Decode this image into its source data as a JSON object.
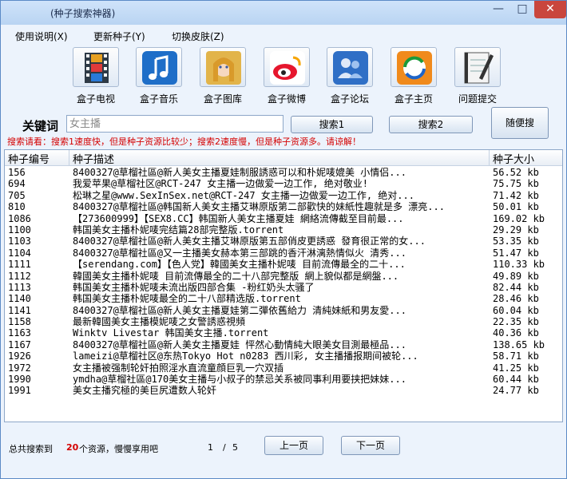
{
  "window": {
    "title": "(种子搜索神器)",
    "min": "—",
    "max": "□",
    "close": "✕"
  },
  "menu": [
    "使用说明(X)",
    "更新种子(Y)",
    "切换皮肤(Z)"
  ],
  "toolbar": [
    {
      "label": "盒子电视",
      "icon": "film-icon"
    },
    {
      "label": "盒子音乐",
      "icon": "music-note-icon"
    },
    {
      "label": "盒子图库",
      "icon": "portrait-icon"
    },
    {
      "label": "盒子微博",
      "icon": "weibo-icon"
    },
    {
      "label": "盒子论坛",
      "icon": "people-icon"
    },
    {
      "label": "盒子主页",
      "icon": "refresh-globe-icon"
    },
    {
      "label": "问题提交",
      "icon": "notebook-pen-icon"
    }
  ],
  "search": {
    "label": "关键词",
    "value": "",
    "placeholder": "女主播",
    "btn1": "搜索1",
    "btn2": "搜索2",
    "random": "随便搜",
    "hint": "搜索请看：搜索1速度快，但是种子资源比较少；搜索2速度慢，但是种子资源多。请谅解！"
  },
  "table": {
    "headers": [
      "种子编号",
      "种子描述",
      "种子大小"
    ],
    "rows": [
      {
        "id": "156",
        "desc": "8400327@草榴社區@新人美女主播夏娃制服誘惑可以和朴妮唛媲美 小情侣...",
        "size": "56.52 kb"
      },
      {
        "id": "694",
        "desc": "我爱苹果@草榴社区@RCT-247 女主播一边做爱一边工作, 绝对敬业!",
        "size": "75.75 kb"
      },
      {
        "id": "705",
        "desc": "松琳之星@www.SexInSex.net@RCT-247 女主播一边做爱一边工作, 绝对...",
        "size": "71.42 kb"
      },
      {
        "id": "810",
        "desc": "8400327@草榴社區@韩国新人美女主播艾琳原版第二部歡快的妹紙性趣就是多 漂亮...",
        "size": "50.01 kb"
      },
      {
        "id": "1086",
        "desc": "【273600999】【SEX8.CC】韩国新人美女主播夏娃 網絡流傳截至目前最...",
        "size": "169.02 kb"
      },
      {
        "id": "1100",
        "desc": "韩国美女主播朴妮唛完结篇28部完整版.torrent",
        "size": "29.29 kb"
      },
      {
        "id": "1103",
        "desc": "8400327@草榴社區@新人美女主播艾琳原版第五部俏皮更誘惑 發育很正常的女...",
        "size": "53.35 kb"
      },
      {
        "id": "1104",
        "desc": "8400327@草榴社區@又一主播美女赫本第三部跳的香汗淋漓熱情似火 清秀...",
        "size": "51.47 kb"
      },
      {
        "id": "1111",
        "desc": "【serendang.com】【色人党】韓國美女主播朴妮唛 目前流傳最全的二十...",
        "size": "110.33 kb"
      },
      {
        "id": "1112",
        "desc": "韓國美女主播朴妮唛 目前流傳最全的二十八部完整版 網上貌似都是網盤...",
        "size": "49.89 kb"
      },
      {
        "id": "1113",
        "desc": "韩国美女主播朴妮唛未流出版四部合集 -粉红奶头太骚了",
        "size": "82.44 kb"
      },
      {
        "id": "1140",
        "desc": "韩国美女主播朴妮唛最全的二十八部精选版.torrent",
        "size": "28.46 kb"
      },
      {
        "id": "1141",
        "desc": "8400327@草榴社區@新人美女主播夏娃第二彈依舊給力 清純妹紙和男友愛...",
        "size": "60.04 kb"
      },
      {
        "id": "1158",
        "desc": "最新韓國美女主播模妮唛之女警誘惑視頻",
        "size": "22.35 kb"
      },
      {
        "id": "1163",
        "desc": "Winktv Livestar 韩国美女主播.torrent",
        "size": "40.36 kb"
      },
      {
        "id": "1167",
        "desc": "8400327@草榴社區@新人美女主播夏娃 怦然心動情純大眼美女目測最極品...",
        "size": "138.65 kb"
      },
      {
        "id": "1926",
        "desc": "lameizi@草榴社区@东热Tokyo Hot n0283 西川彩, 女主播播报期间被轮...",
        "size": "58.71 kb"
      },
      {
        "id": "1972",
        "desc": "女主播被强制轮奸拍照淫水直流童顔巨乳一穴双插",
        "size": "41.25 kb"
      },
      {
        "id": "1990",
        "desc": "ymdha@草榴社區@170美女主播与小叔子的禁忌关系被同事利用要挟把妹妹...",
        "size": "60.44 kb"
      },
      {
        "id": "1991",
        "desc": "美女主播究極的美巨尻遭数人轮奸",
        "size": "24.77 kb"
      }
    ]
  },
  "status": {
    "prefix": "总共搜索到",
    "count": "20",
    "suffix": "个资源，慢慢享用吧",
    "page": "1",
    "sep": "/",
    "pages": "5",
    "prev": "上一页",
    "next": "下一页"
  },
  "colors": {
    "accent": "#1b4f9c",
    "hint": "#d40000",
    "close": "#c9463d"
  }
}
